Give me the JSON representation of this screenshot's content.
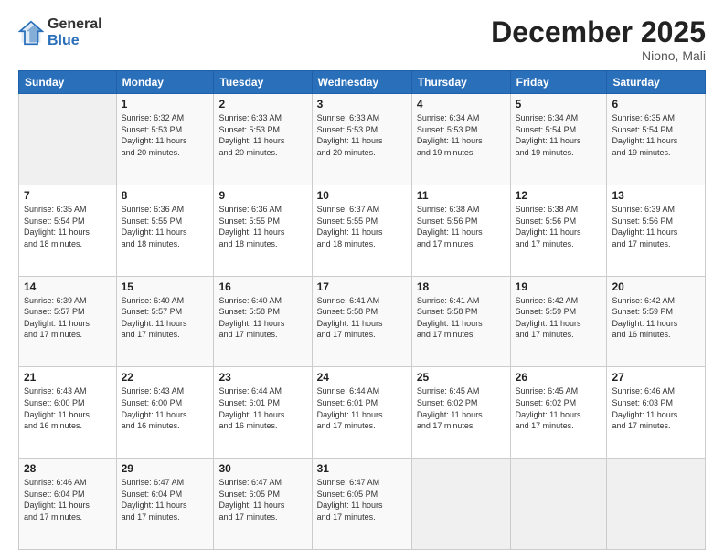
{
  "logo": {
    "general": "General",
    "blue": "Blue"
  },
  "header": {
    "month": "December 2025",
    "location": "Niono, Mali"
  },
  "days_of_week": [
    "Sunday",
    "Monday",
    "Tuesday",
    "Wednesday",
    "Thursday",
    "Friday",
    "Saturday"
  ],
  "weeks": [
    [
      {
        "day": "",
        "info": ""
      },
      {
        "day": "1",
        "info": "Sunrise: 6:32 AM\nSunset: 5:53 PM\nDaylight: 11 hours\nand 20 minutes."
      },
      {
        "day": "2",
        "info": "Sunrise: 6:33 AM\nSunset: 5:53 PM\nDaylight: 11 hours\nand 20 minutes."
      },
      {
        "day": "3",
        "info": "Sunrise: 6:33 AM\nSunset: 5:53 PM\nDaylight: 11 hours\nand 20 minutes."
      },
      {
        "day": "4",
        "info": "Sunrise: 6:34 AM\nSunset: 5:53 PM\nDaylight: 11 hours\nand 19 minutes."
      },
      {
        "day": "5",
        "info": "Sunrise: 6:34 AM\nSunset: 5:54 PM\nDaylight: 11 hours\nand 19 minutes."
      },
      {
        "day": "6",
        "info": "Sunrise: 6:35 AM\nSunset: 5:54 PM\nDaylight: 11 hours\nand 19 minutes."
      }
    ],
    [
      {
        "day": "7",
        "info": "Sunrise: 6:35 AM\nSunset: 5:54 PM\nDaylight: 11 hours\nand 18 minutes."
      },
      {
        "day": "8",
        "info": "Sunrise: 6:36 AM\nSunset: 5:55 PM\nDaylight: 11 hours\nand 18 minutes."
      },
      {
        "day": "9",
        "info": "Sunrise: 6:36 AM\nSunset: 5:55 PM\nDaylight: 11 hours\nand 18 minutes."
      },
      {
        "day": "10",
        "info": "Sunrise: 6:37 AM\nSunset: 5:55 PM\nDaylight: 11 hours\nand 18 minutes."
      },
      {
        "day": "11",
        "info": "Sunrise: 6:38 AM\nSunset: 5:56 PM\nDaylight: 11 hours\nand 17 minutes."
      },
      {
        "day": "12",
        "info": "Sunrise: 6:38 AM\nSunset: 5:56 PM\nDaylight: 11 hours\nand 17 minutes."
      },
      {
        "day": "13",
        "info": "Sunrise: 6:39 AM\nSunset: 5:56 PM\nDaylight: 11 hours\nand 17 minutes."
      }
    ],
    [
      {
        "day": "14",
        "info": "Sunrise: 6:39 AM\nSunset: 5:57 PM\nDaylight: 11 hours\nand 17 minutes."
      },
      {
        "day": "15",
        "info": "Sunrise: 6:40 AM\nSunset: 5:57 PM\nDaylight: 11 hours\nand 17 minutes."
      },
      {
        "day": "16",
        "info": "Sunrise: 6:40 AM\nSunset: 5:58 PM\nDaylight: 11 hours\nand 17 minutes."
      },
      {
        "day": "17",
        "info": "Sunrise: 6:41 AM\nSunset: 5:58 PM\nDaylight: 11 hours\nand 17 minutes."
      },
      {
        "day": "18",
        "info": "Sunrise: 6:41 AM\nSunset: 5:58 PM\nDaylight: 11 hours\nand 17 minutes."
      },
      {
        "day": "19",
        "info": "Sunrise: 6:42 AM\nSunset: 5:59 PM\nDaylight: 11 hours\nand 17 minutes."
      },
      {
        "day": "20",
        "info": "Sunrise: 6:42 AM\nSunset: 5:59 PM\nDaylight: 11 hours\nand 16 minutes."
      }
    ],
    [
      {
        "day": "21",
        "info": "Sunrise: 6:43 AM\nSunset: 6:00 PM\nDaylight: 11 hours\nand 16 minutes."
      },
      {
        "day": "22",
        "info": "Sunrise: 6:43 AM\nSunset: 6:00 PM\nDaylight: 11 hours\nand 16 minutes."
      },
      {
        "day": "23",
        "info": "Sunrise: 6:44 AM\nSunset: 6:01 PM\nDaylight: 11 hours\nand 16 minutes."
      },
      {
        "day": "24",
        "info": "Sunrise: 6:44 AM\nSunset: 6:01 PM\nDaylight: 11 hours\nand 17 minutes."
      },
      {
        "day": "25",
        "info": "Sunrise: 6:45 AM\nSunset: 6:02 PM\nDaylight: 11 hours\nand 17 minutes."
      },
      {
        "day": "26",
        "info": "Sunrise: 6:45 AM\nSunset: 6:02 PM\nDaylight: 11 hours\nand 17 minutes."
      },
      {
        "day": "27",
        "info": "Sunrise: 6:46 AM\nSunset: 6:03 PM\nDaylight: 11 hours\nand 17 minutes."
      }
    ],
    [
      {
        "day": "28",
        "info": "Sunrise: 6:46 AM\nSunset: 6:04 PM\nDaylight: 11 hours\nand 17 minutes."
      },
      {
        "day": "29",
        "info": "Sunrise: 6:47 AM\nSunset: 6:04 PM\nDaylight: 11 hours\nand 17 minutes."
      },
      {
        "day": "30",
        "info": "Sunrise: 6:47 AM\nSunset: 6:05 PM\nDaylight: 11 hours\nand 17 minutes."
      },
      {
        "day": "31",
        "info": "Sunrise: 6:47 AM\nSunset: 6:05 PM\nDaylight: 11 hours\nand 17 minutes."
      },
      {
        "day": "",
        "info": ""
      },
      {
        "day": "",
        "info": ""
      },
      {
        "day": "",
        "info": ""
      }
    ]
  ]
}
